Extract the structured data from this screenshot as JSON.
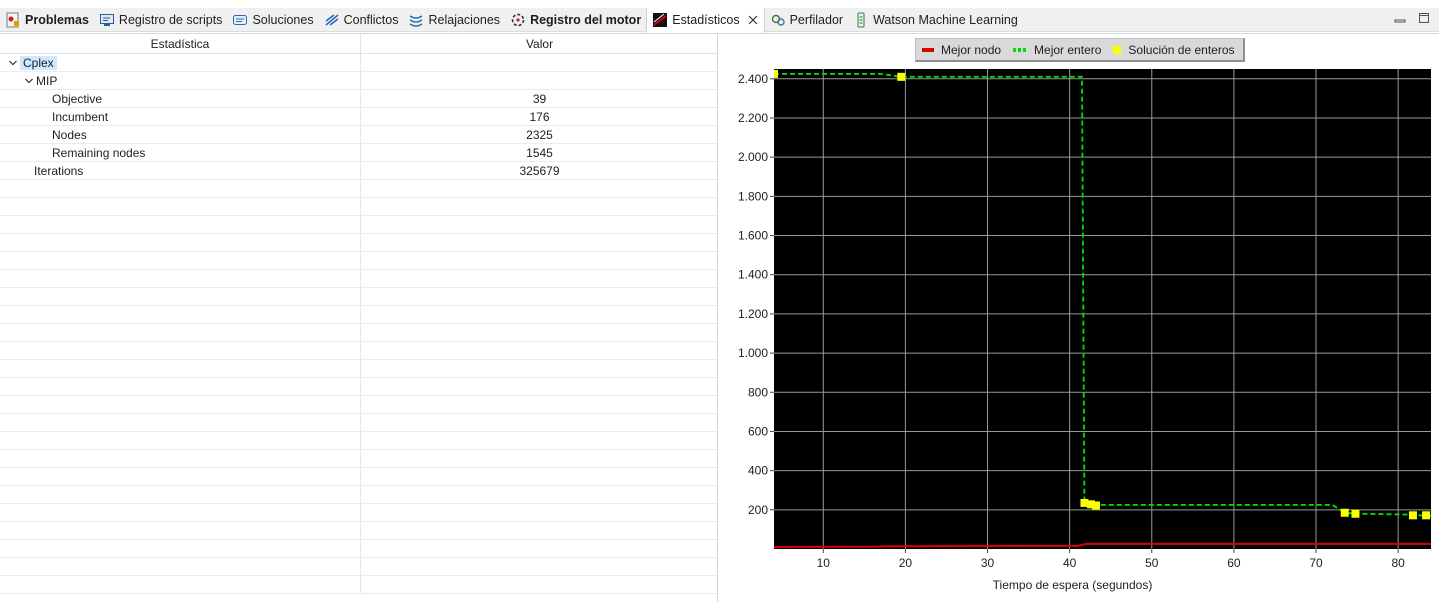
{
  "tabs": [
    {
      "label": "Problemas",
      "icon": "problems-icon",
      "bold": true
    },
    {
      "label": "Registro de scripts",
      "icon": "console-icon",
      "bold": false
    },
    {
      "label": "Soluciones",
      "icon": "solutions-icon",
      "bold": false
    },
    {
      "label": "Conflictos",
      "icon": "conflicts-icon",
      "bold": false
    },
    {
      "label": "Relajaciones",
      "icon": "relaxations-icon",
      "bold": false
    },
    {
      "label": "Registro del motor",
      "icon": "engine-log-icon",
      "bold": true
    },
    {
      "label": "Estadísticos",
      "icon": "statistics-icon",
      "bold": false,
      "active": true
    },
    {
      "label": "Perfilador",
      "icon": "profiler-icon",
      "bold": false
    },
    {
      "label": "Watson Machine Learning",
      "icon": "watson-icon",
      "bold": false
    }
  ],
  "table": {
    "headers": [
      "Estadística",
      "Valor"
    ],
    "rows": [
      {
        "label": "Cplex",
        "value": "",
        "indent": 0,
        "expanded": true,
        "selected": true
      },
      {
        "label": "MIP",
        "value": "",
        "indent": 1,
        "expanded": true
      },
      {
        "label": "Objective",
        "value": "39",
        "indent": 2
      },
      {
        "label": "Incumbent",
        "value": "176",
        "indent": 2
      },
      {
        "label": "Nodes",
        "value": "2325",
        "indent": 2
      },
      {
        "label": "Remaining nodes",
        "value": "1545",
        "indent": 2
      },
      {
        "label": "Iterations",
        "value": "325679",
        "indent": 1
      }
    ],
    "empty_rows": 23
  },
  "colors": {
    "plot_bg": "#000000",
    "grid": "#9a9a9a",
    "best_node": "#e00000",
    "best_integer": "#00e000",
    "integer_solution": "#ffff00",
    "selection": "#cde8ff"
  },
  "chart_data": {
    "type": "line",
    "legend": [
      "Mejor nodo",
      "Mejor entero",
      "Solución de enteros"
    ],
    "legend_position": "top-center",
    "xlabel": "Tiempo de espera (segundos)",
    "ylabel": "",
    "xlim": [
      4,
      84
    ],
    "ylim": [
      0,
      2450
    ],
    "x_ticks": [
      10,
      20,
      30,
      40,
      50,
      60,
      70,
      80
    ],
    "y_ticks": [
      200,
      400,
      600,
      800,
      1000,
      1200,
      1400,
      1600,
      1800,
      2000,
      2200,
      2400
    ],
    "y_tick_labels": [
      "200",
      "400",
      "600",
      "800",
      "1.000",
      "1.200",
      "1.400",
      "1.600",
      "1.800",
      "2.000",
      "2.200",
      "2.400"
    ],
    "grid": true,
    "series": [
      {
        "name": "Mejor nodo",
        "style": "solid",
        "x": [
          4,
          16.5,
          17.5,
          41,
          42,
          84
        ],
        "y": [
          10,
          12,
          14,
          16,
          26,
          26
        ]
      },
      {
        "name": "Mejor entero",
        "style": "dashed",
        "x": [
          4,
          17,
          19.5,
          19.5,
          41.5,
          41.8,
          42,
          42,
          72,
          73.5,
          75,
          82,
          83,
          84
        ],
        "y": [
          2425,
          2425,
          2410,
          2410,
          2410,
          240,
          235,
          225,
          225,
          185,
          180,
          175,
          170,
          170
        ]
      }
    ],
    "points": {
      "name": "Solución de enteros",
      "x": [
        4,
        19.5,
        41.8,
        42.6,
        43.2,
        73.5,
        74.8,
        81.8,
        83.4
      ],
      "y": [
        2425,
        2410,
        235,
        228,
        222,
        185,
        180,
        172,
        172
      ]
    }
  }
}
